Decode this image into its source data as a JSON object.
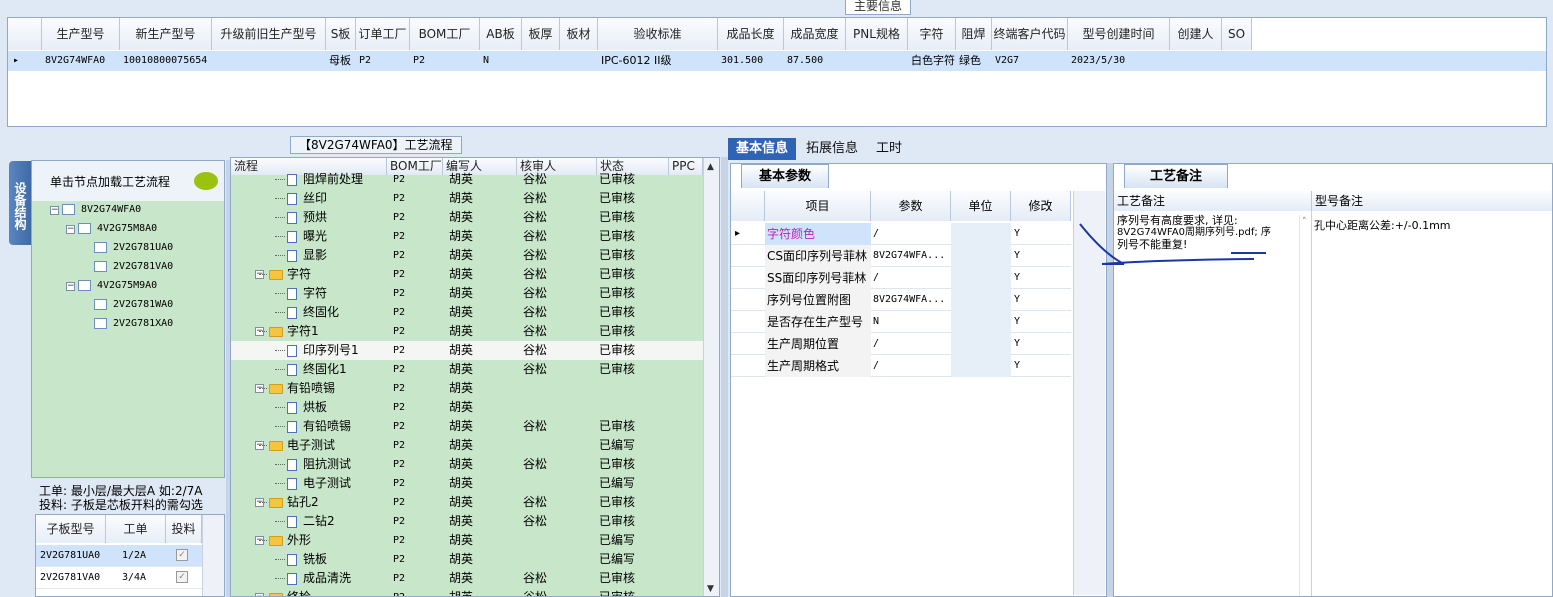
{
  "top_panel": {
    "caption": "主要信息",
    "columns": [
      "生产型号",
      "新生产型号",
      "升级前旧生产型号",
      "S板",
      "订单工厂",
      "BOM工厂",
      "AB板",
      "板厚",
      "板材",
      "验收标准",
      "成品长度",
      "成品宽度",
      "PNL规格",
      "字符",
      "阻焊",
      "终端客户代码",
      "型号创建时间",
      "创建人",
      "SO"
    ],
    "row": {
      "production_model": "8V2G74WFA0",
      "new_model": "10010800075654",
      "old_model": "",
      "s_board": "母板",
      "order_factory": "P2",
      "bom_factory": "P2",
      "ab_board": "N",
      "thickness": "",
      "material": "",
      "acceptance": "IPC-6012 II级",
      "length": "301.500",
      "width": "87.500",
      "pnl": "",
      "char": "白色字符",
      "solder_mask": "绿色",
      "customer_code": "V2G7",
      "created_time": "2023/5/30",
      "creator": "",
      "so": ""
    }
  },
  "process_title": "【8V2G74WFA0】工艺流程",
  "left_panel": {
    "vertical_tab": "设备结构",
    "hint": "单击节点加载工艺流程",
    "tree": [
      {
        "label": "8V2G74WFA0",
        "level": 0
      },
      {
        "label": "4V2G75M8A0",
        "level": 1
      },
      {
        "label": "2V2G781UA0",
        "level": 2
      },
      {
        "label": "2V2G781VA0",
        "level": 2
      },
      {
        "label": "4V2G75M9A0",
        "level": 1
      },
      {
        "label": "2V2G781WA0",
        "level": 2
      },
      {
        "label": "2V2G781XA0",
        "level": 2
      }
    ],
    "note_line1": "工单: 最小层/最大层A 如:2/7A",
    "note_line2": "投料: 子板是芯板开料的需勾选",
    "subgrid": {
      "columns": [
        "子板型号",
        "工单",
        "投料"
      ],
      "rows": [
        {
          "model": "2V2G781UA0",
          "order": "1/2A",
          "checked": true
        },
        {
          "model": "2V2G781VA0",
          "order": "3/4A",
          "checked": true
        }
      ]
    }
  },
  "process": {
    "columns": [
      "流程",
      "BOM工厂",
      "编写人",
      "核审人",
      "状态",
      "PPC"
    ],
    "rows": [
      {
        "type": "step",
        "label": "阻焊前处理",
        "bom": "P2",
        "writer": "胡英",
        "reviewer": "谷松",
        "status": "已审核"
      },
      {
        "type": "step",
        "label": "丝印",
        "bom": "P2",
        "writer": "胡英",
        "reviewer": "谷松",
        "status": "已审核"
      },
      {
        "type": "step",
        "label": "预烘",
        "bom": "P2",
        "writer": "胡英",
        "reviewer": "谷松",
        "status": "已审核"
      },
      {
        "type": "step",
        "label": "曝光",
        "bom": "P2",
        "writer": "胡英",
        "reviewer": "谷松",
        "status": "已审核"
      },
      {
        "type": "step",
        "label": "显影",
        "bom": "P2",
        "writer": "胡英",
        "reviewer": "谷松",
        "status": "已审核"
      },
      {
        "type": "group",
        "label": "字符",
        "bom": "P2",
        "writer": "胡英",
        "reviewer": "谷松",
        "status": "已审核"
      },
      {
        "type": "step",
        "label": "字符",
        "bom": "P2",
        "writer": "胡英",
        "reviewer": "谷松",
        "status": "已审核"
      },
      {
        "type": "step",
        "label": "终固化",
        "bom": "P2",
        "writer": "胡英",
        "reviewer": "谷松",
        "status": "已审核"
      },
      {
        "type": "group",
        "label": "字符1",
        "bom": "P2",
        "writer": "胡英",
        "reviewer": "谷松",
        "status": "已审核"
      },
      {
        "type": "step",
        "label": "印序列号1",
        "bom": "P2",
        "writer": "胡英",
        "reviewer": "谷松",
        "status": "已审核",
        "selected": true
      },
      {
        "type": "step",
        "label": "终固化1",
        "bom": "P2",
        "writer": "胡英",
        "reviewer": "谷松",
        "status": "已审核"
      },
      {
        "type": "group",
        "label": "有铅喷锡",
        "bom": "P2",
        "writer": "胡英",
        "reviewer": "",
        "status": ""
      },
      {
        "type": "step",
        "label": "烘板",
        "bom": "P2",
        "writer": "胡英",
        "reviewer": "",
        "status": ""
      },
      {
        "type": "step",
        "label": "有铅喷锡",
        "bom": "P2",
        "writer": "胡英",
        "reviewer": "谷松",
        "status": "已审核"
      },
      {
        "type": "group",
        "label": "电子测试",
        "bom": "P2",
        "writer": "胡英",
        "reviewer": "",
        "status": "已编写"
      },
      {
        "type": "step",
        "label": "阻抗测试",
        "bom": "P2",
        "writer": "胡英",
        "reviewer": "谷松",
        "status": "已审核"
      },
      {
        "type": "step",
        "label": "电子测试",
        "bom": "P2",
        "writer": "胡英",
        "reviewer": "",
        "status": "已编写"
      },
      {
        "type": "group",
        "label": "钻孔2",
        "bom": "P2",
        "writer": "胡英",
        "reviewer": "谷松",
        "status": "已审核"
      },
      {
        "type": "step",
        "label": "二钻2",
        "bom": "P2",
        "writer": "胡英",
        "reviewer": "谷松",
        "status": "已审核"
      },
      {
        "type": "group",
        "label": "外形",
        "bom": "P2",
        "writer": "胡英",
        "reviewer": "",
        "status": "已编写"
      },
      {
        "type": "step",
        "label": "铣板",
        "bom": "P2",
        "writer": "胡英",
        "reviewer": "",
        "status": "已编写"
      },
      {
        "type": "step",
        "label": "成品清洗",
        "bom": "P2",
        "writer": "胡英",
        "reviewer": "谷松",
        "status": "已审核"
      },
      {
        "type": "group",
        "label": "终检",
        "bom": "P2",
        "writer": "胡英",
        "reviewer": "谷松",
        "status": "已审核"
      }
    ]
  },
  "right_tabs": [
    "基本信息",
    "拓展信息",
    "工时"
  ],
  "basic": {
    "section_title": "基本参数",
    "columns": [
      "项目",
      "参数",
      "单位",
      "修改"
    ],
    "rows": [
      {
        "item": "字符颜色",
        "param": "/",
        "unit": "",
        "edit": "Y",
        "highlight": true
      },
      {
        "item": "CS面印序列号菲林",
        "param": "8V2G74WFA...",
        "unit": "",
        "edit": "Y"
      },
      {
        "item": "SS面印序列号菲林",
        "param": "/",
        "unit": "",
        "edit": "Y"
      },
      {
        "item": "序列号位置附图",
        "param": "8V2G74WFA...",
        "unit": "",
        "edit": "Y"
      },
      {
        "item": "是否存在生产型号",
        "param": "N",
        "unit": "",
        "edit": "Y"
      },
      {
        "item": "生产周期位置",
        "param": "/",
        "unit": "",
        "edit": "Y"
      },
      {
        "item": "生产周期格式",
        "param": "/",
        "unit": "",
        "edit": "Y"
      }
    ]
  },
  "remarks": {
    "section_title": "工艺备注",
    "col_process": "工艺备注",
    "col_model": "型号备注",
    "process_text_1": "序列号有高度要求, 详见:",
    "process_text_2": "8V2G74WFA0周期序列号.pdf; 序",
    "process_text_3": "列号不能重复!",
    "model_text": "孔中心距离公差:+/-0.1mm"
  },
  "colors": {
    "accent": "#2f63b5",
    "tree_bg": "#c8e6c9",
    "selection": "#cfe3fb",
    "highlight_text": "#c020c0"
  }
}
